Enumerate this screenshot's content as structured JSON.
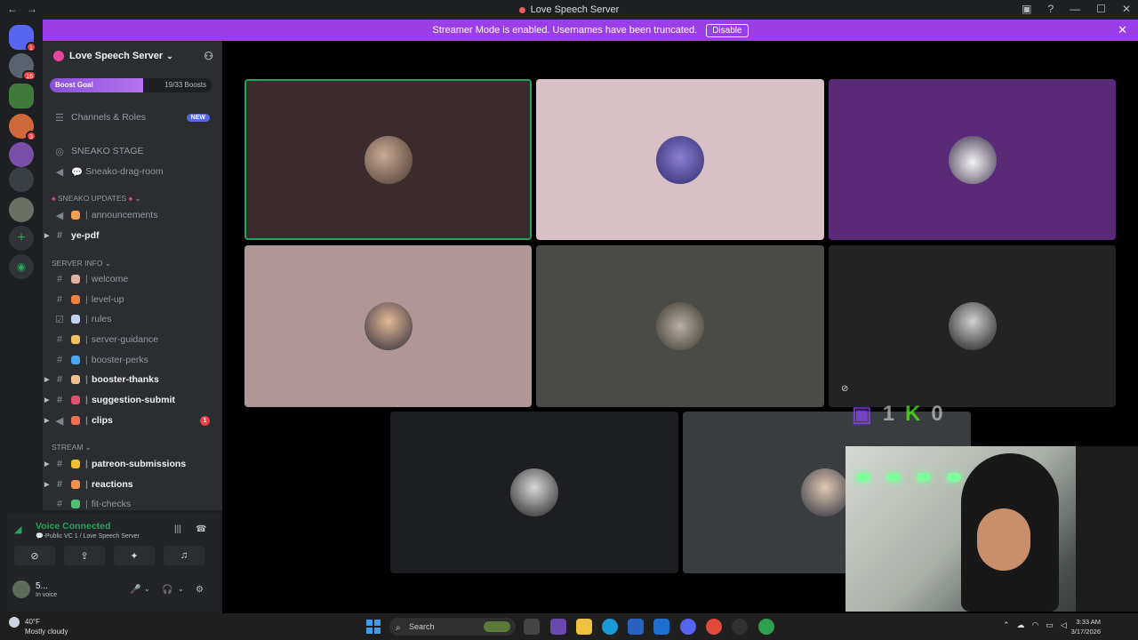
{
  "titlebar": {
    "title": "Love Speech Server",
    "nav_back": "←",
    "nav_forward": "→",
    "min": "—",
    "max": "☐",
    "close": "✕"
  },
  "banner": {
    "text": "Streamer Mode is enabled. Usernames have been truncated.",
    "button": "Disable"
  },
  "servers": {
    "badges": [
      "1",
      "16",
      "3"
    ]
  },
  "sidebar": {
    "server_name": "Love Speech Server",
    "boost": {
      "label": "Boost Goal",
      "count": "19/33 Boosts",
      "progress": 0.576
    },
    "channels_roles": "Channels & Roles",
    "new_badge": "NEW",
    "stage_channel": "SNEAKO STAGE",
    "drag_room": "Sneako-drag-room",
    "cat_updates": "SNEAKO UPDATES",
    "announcements": "announcements",
    "ye_pdf": "ye-pdf",
    "cat_server_info": "SERVER INFO",
    "welcome": "welcome",
    "level_up": "level-up",
    "rules": "rules",
    "server_guidance": "server-guidance",
    "booster_perks": "booster-perks",
    "booster_thanks": "booster-thanks",
    "suggestion_submit": "suggestion-submit",
    "clips": "clips",
    "clips_unread": "1",
    "cat_stream": "STREAM",
    "patreon": "patreon-submissions",
    "reactions": "reactions",
    "fit_checks": "fit-checks",
    "separator": "|"
  },
  "voice": {
    "status": "Voice Connected",
    "channel": "💬-Public VC 1 / Love Speech Server",
    "username": "5...",
    "user_status": "In voice"
  },
  "overlay": {
    "twitch_count": "1",
    "kick_count": "0"
  },
  "taskbar": {
    "temp": "40°F",
    "weather": "Mostly cloudy",
    "search": "Search",
    "time": "3:33 AM",
    "date": "3/17/2026"
  },
  "colors": {
    "accent": "#5865f2",
    "banner": "#9c3ee8",
    "voice_green": "#23a55a",
    "danger": "#f23f43"
  }
}
